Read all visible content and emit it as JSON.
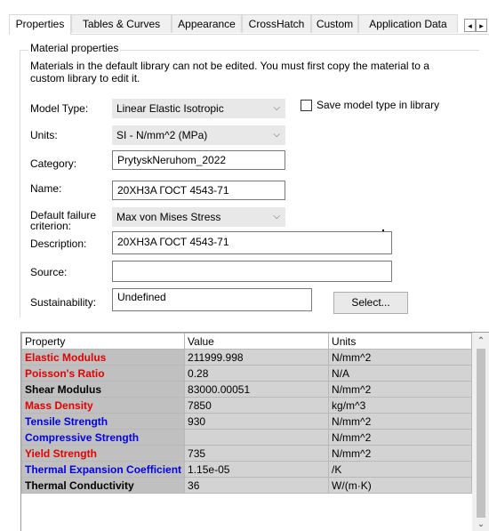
{
  "tabs": [
    "Properties",
    "Tables & Curves",
    "Appearance",
    "CrossHatch",
    "Custom",
    "Application Data"
  ],
  "active_tab": "Properties",
  "tab_nav": {
    "prev": "◂",
    "next": "▸"
  },
  "material": {
    "group_title": "Material properties",
    "description_text": "Materials in the default library can not be edited. You must first copy the material to a custom library to edit it.",
    "model_type_label": "Model Type:",
    "model_type_value": "Linear Elastic Isotropic",
    "save_model_label": "Save model type in library",
    "units_label": "Units:",
    "units_value": "SI - N/mm^2 (MPa)",
    "category_label": "Category:",
    "category_value": "PrytyskNeruhom_2022",
    "name_label": "Name:",
    "name_value": "20XH3A ГОСТ 4543-71",
    "failure_label_1": "Default failure",
    "failure_label_2": "criterion:",
    "failure_value": "Max von Mises Stress",
    "description_label": "Description:",
    "description_value": "20XH3A ГОСТ 4543-71",
    "source_label": "Source:",
    "source_value": "",
    "sustainability_label": "Sustainability:",
    "sustainability_value": "Undefined",
    "select_button": "Select..."
  },
  "table": {
    "headers": [
      "Property",
      "Value",
      "Units"
    ],
    "rows": [
      {
        "property": "Elastic Modulus",
        "value": "211999.998",
        "units": "N/mm^2",
        "color": "#e00000"
      },
      {
        "property": "Poisson's Ratio",
        "value": "0.28",
        "units": "N/A",
        "color": "#e00000"
      },
      {
        "property": "Shear Modulus",
        "value": "83000.00051",
        "units": "N/mm^2",
        "color": "#000000"
      },
      {
        "property": "Mass Density",
        "value": "7850",
        "units": "kg/m^3",
        "color": "#e00000"
      },
      {
        "property": "Tensile Strength",
        "value": "930",
        "units": "N/mm^2",
        "color": "#0000e0"
      },
      {
        "property": "Compressive Strength",
        "value": "",
        "units": "N/mm^2",
        "color": "#0000e0"
      },
      {
        "property": "Yield Strength",
        "value": "735",
        "units": "N/mm^2",
        "color": "#e00000"
      },
      {
        "property": "Thermal Expansion Coefficient",
        "value": "1.15e-05",
        "units": "/K",
        "color": "#0000e0"
      },
      {
        "property": "Thermal Conductivity",
        "value": "36",
        "units": "W/(m·K)",
        "color": "#000000"
      }
    ]
  },
  "icons": {
    "dropdown": "chevron-down-icon",
    "scroll_up": "chevron-up-icon",
    "scroll_down": "chevron-down-icon"
  }
}
